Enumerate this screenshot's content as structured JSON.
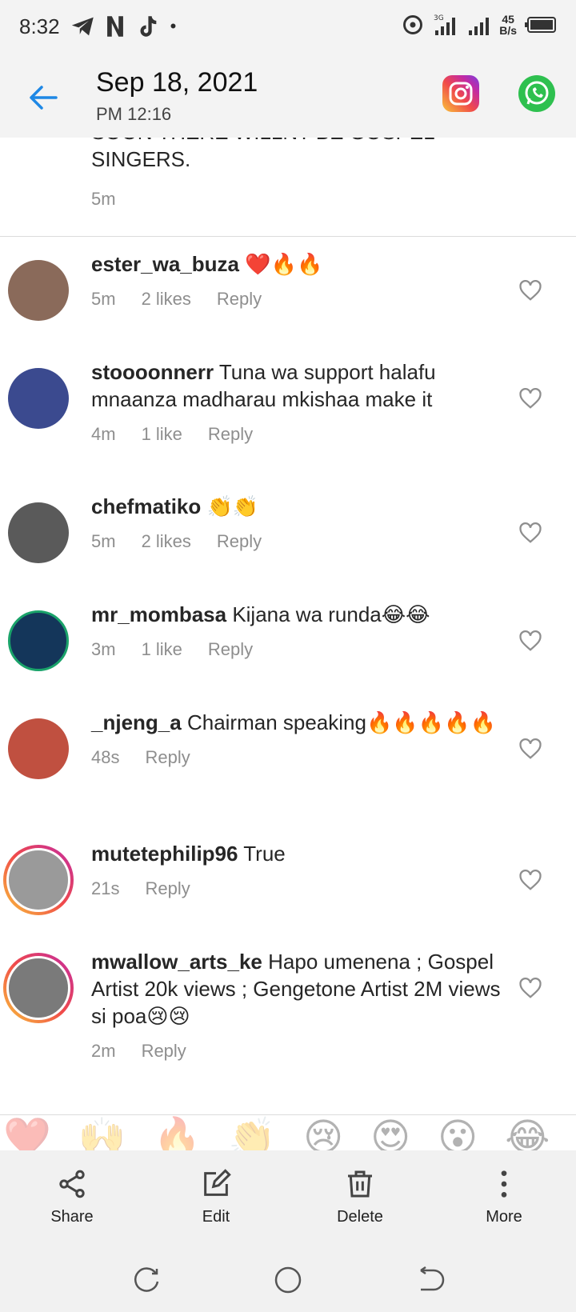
{
  "status_bar": {
    "time": "8:32",
    "network": "3G",
    "speed_top": "45",
    "speed_bottom": "B/s"
  },
  "header": {
    "date": "Sep 18, 2021",
    "time": "PM 12:16"
  },
  "partial_comment": {
    "text_line1": "SOON THERE WILLNT BE GOSPEL",
    "text_line2": "SINGERS.",
    "time": "5m"
  },
  "comments": [
    {
      "username": "ester_wa_buza",
      "text": "❤️🔥🔥",
      "time": "5m",
      "likes": "2 likes",
      "reply": "Reply",
      "avatar_color": "#8a6a5a"
    },
    {
      "username": "stoooonnerr",
      "text": "Tuna wa support halafu mnaanza madharau mkishaa make it",
      "time": "4m",
      "likes": "1 like",
      "reply": "Reply",
      "avatar_color": "#3b4a8f"
    },
    {
      "username": "chefmatiko",
      "text": "👏👏",
      "time": "5m",
      "likes": "2 likes",
      "reply": "Reply",
      "avatar_color": "#5a5a5a"
    },
    {
      "username": "mr_mombasa",
      "text": "Kijana wa runda😂😂",
      "time": "3m",
      "likes": "1 like",
      "reply": "Reply",
      "avatar_color": "#14365a"
    },
    {
      "username": "_njeng_a",
      "text": "Chairman speaking🔥🔥🔥🔥🔥",
      "time": "48s",
      "likes": "",
      "reply": "Reply",
      "avatar_color": "#c05040"
    },
    {
      "username": "mutetephilip96",
      "text": "True",
      "time": "21s",
      "likes": "",
      "reply": "Reply",
      "avatar_color": "#8b8b8b"
    },
    {
      "username": "mwallow_arts_ke",
      "text": "Hapo umenena ; Gospel Artist 20k views ; Gengetone Artist 2M views si poa😢😢",
      "time": "2m",
      "likes": "",
      "reply": "Reply",
      "avatar_color": "#7a7a7a"
    }
  ],
  "reactions": [
    "❤️",
    "🙌",
    "🔥",
    "👏",
    "😢",
    "😍",
    "😮",
    "😂"
  ],
  "actions": {
    "share": "Share",
    "edit": "Edit",
    "delete": "Delete",
    "more": "More"
  },
  "colors": {
    "accent_blue": "#1e88e5",
    "meta_gray": "#8e8e8e"
  }
}
